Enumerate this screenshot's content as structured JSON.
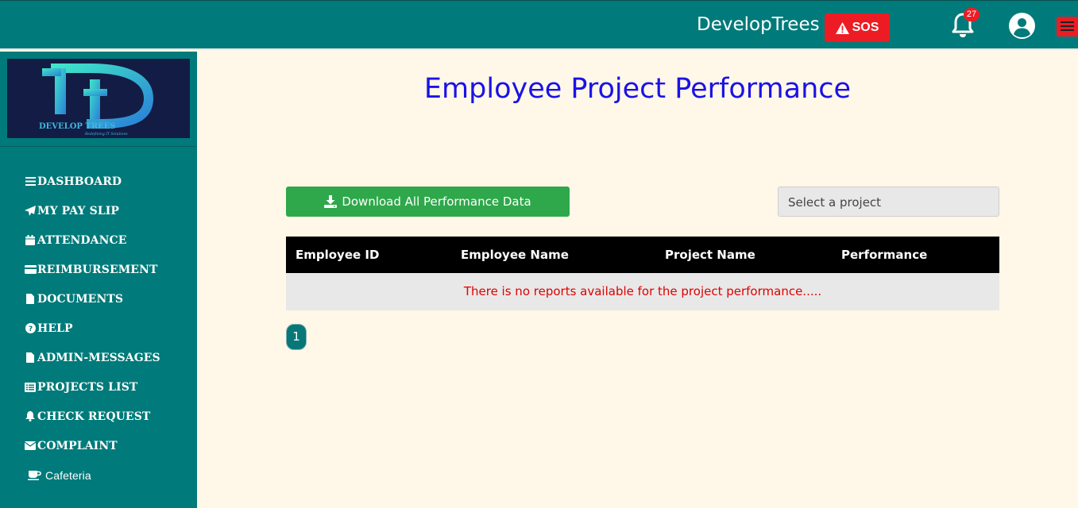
{
  "header": {
    "brand": "DevelopTrees",
    "sos_label": "SOS",
    "notification_count": "27"
  },
  "sidebar": {
    "logo_text": "DEVELOP TREES",
    "logo_tagline": "Redefining IT Solutions",
    "items": [
      {
        "label": "DASHBOARD",
        "icon": "bars-icon"
      },
      {
        "label": "MY PAY SLIP",
        "icon": "paper-plane-icon"
      },
      {
        "label": "ATTENDANCE",
        "icon": "calendar-icon"
      },
      {
        "label": "REIMBURSEMENT",
        "icon": "credit-card-icon"
      },
      {
        "label": "DOCUMENTS",
        "icon": "file-icon"
      },
      {
        "label": "HELP",
        "icon": "question-circle-icon"
      },
      {
        "label": "ADMIN-MESSAGES",
        "icon": "file-icon"
      },
      {
        "label": "PROJECTS LIST",
        "icon": "list-icon"
      },
      {
        "label": "CHECK REQUEST",
        "icon": "bell-icon"
      },
      {
        "label": "COMPLAINT",
        "icon": "envelope-icon"
      },
      {
        "label": "Cafeteria",
        "icon": "coffee-icon"
      }
    ]
  },
  "main": {
    "title": "Employee Project Performance",
    "download_label": "Download All Performance Data",
    "select_placeholder": "Select a project",
    "table": {
      "columns": [
        "Employee ID",
        "Employee Name",
        "Project Name",
        "Performance"
      ],
      "empty_message": "There is no reports available for the project performance....."
    },
    "pagination": {
      "current": "1"
    }
  },
  "colors": {
    "teal": "#007a7a",
    "sos_red": "#ed1c24",
    "title_blue": "#1a12e6",
    "download_green": "#2ea84a",
    "page_bg": "#fff7e8",
    "empty_text_red": "#e00000"
  }
}
